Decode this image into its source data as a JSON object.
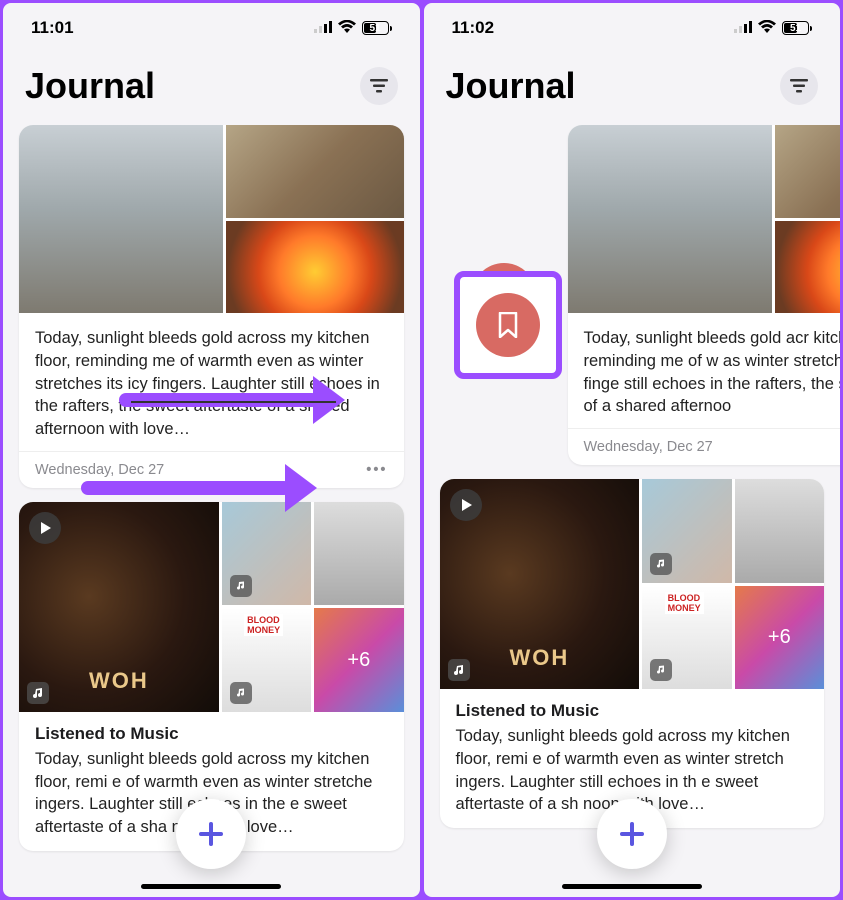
{
  "left": {
    "status": {
      "time": "11:01",
      "battery": "51"
    },
    "header": {
      "title": "Journal"
    },
    "entry": {
      "text": "Today, sunlight bleeds gold across my kitchen floor, reminding me of warmth even as winter stretches its icy fingers. Laughter still echoes in the rafters, the sweet aftertaste of a shared afternoon with love…",
      "date": "Wednesday, Dec 27"
    },
    "music": {
      "album": "WOH",
      "overflow": "+6",
      "title": "Listened to Music",
      "text": "Today, sunlight bleeds gold across my kitchen floor, remi                e of warmth even as winter stretche                ingers. Laughter still echoes in the                e sweet aftertaste of a sha                 noon with love…"
    }
  },
  "right": {
    "status": {
      "time": "11:02",
      "battery": "51"
    },
    "header": {
      "title": "Journal"
    },
    "entry": {
      "text": "Today, sunlight bleeds gold acr kitchen floor, reminding me of w as winter stretches its icy finge still echoes in the rafters, the s aftertaste of a shared afternoo",
      "date": "Wednesday, Dec 27"
    },
    "music": {
      "album": "WOH",
      "overflow": "+6",
      "title": "Listened to Music",
      "text": "Today, sunlight bleeds gold across my kitchen floor, remi                e of warmth even as winter stretch                 ingers. Laughter still echoes in th                 e sweet aftertaste of a sh                  noon with love…"
    }
  }
}
